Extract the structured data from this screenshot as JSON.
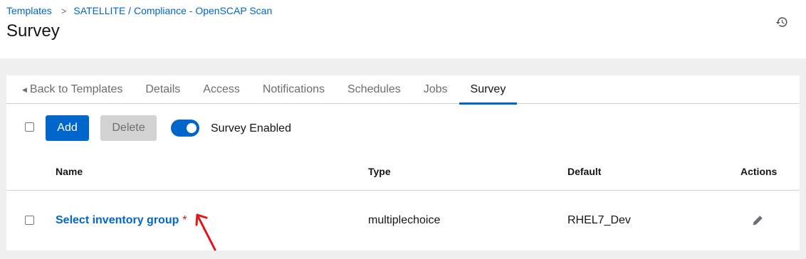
{
  "breadcrumb": {
    "items": [
      {
        "label": "Templates"
      },
      {
        "label": "SATELLITE / Compliance - OpenSCAP Scan"
      }
    ],
    "separator": ">"
  },
  "page": {
    "title": "Survey"
  },
  "header_actions": {
    "history_icon": "history-icon"
  },
  "tabs": [
    {
      "label": "Back to Templates",
      "icon": "caret-left-icon"
    },
    {
      "label": "Details"
    },
    {
      "label": "Access"
    },
    {
      "label": "Notifications"
    },
    {
      "label": "Schedules"
    },
    {
      "label": "Jobs"
    },
    {
      "label": "Survey",
      "active": true
    }
  ],
  "toolbar": {
    "add_label": "Add",
    "delete_label": "Delete",
    "survey_toggle": {
      "label": "Survey Enabled",
      "checked": true
    }
  },
  "table": {
    "columns": [
      "Name",
      "Type",
      "Default",
      "Actions"
    ],
    "rows": [
      {
        "name": "Select inventory group",
        "required_marker": "*",
        "type": "multiplechoice",
        "default": "RHEL7_Dev",
        "action_icon": "pencil-icon"
      }
    ]
  },
  "colors": {
    "accent": "#0066cc",
    "required": "#c9190b",
    "annotation": "#e8121a"
  }
}
